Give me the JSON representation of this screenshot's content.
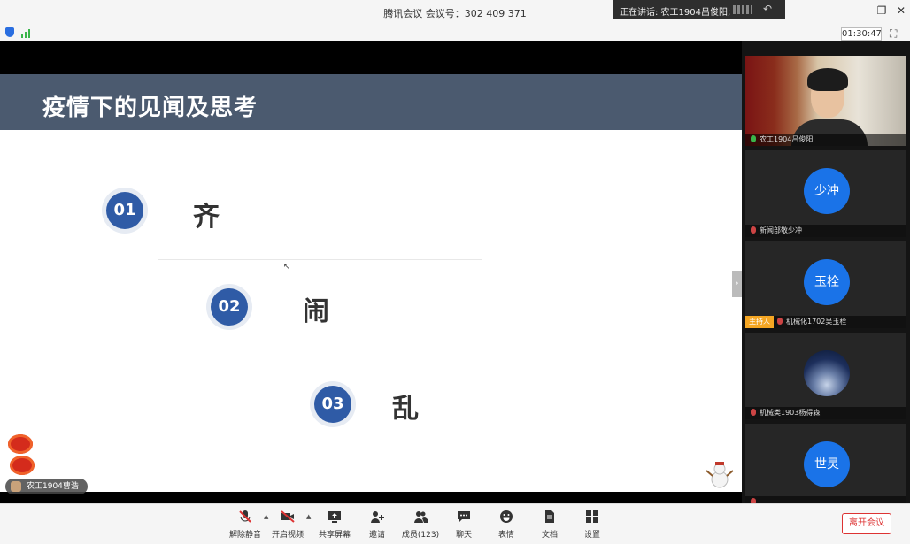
{
  "window": {
    "title": "腾讯会议 会议号：302 409 371",
    "speaking_text": "正在讲话: 农工1904吕俊阳;",
    "timer": "01:30:47"
  },
  "slide": {
    "title": "疫情下的见闻及思考",
    "items": [
      {
        "num": "01",
        "word": "齐"
      },
      {
        "num": "02",
        "word": "闹"
      },
      {
        "num": "03",
        "word": "乱"
      }
    ],
    "presenter_tag": "农工1904曹浩"
  },
  "participants": {
    "camera": {
      "name": "农工1904吕俊阳"
    },
    "tiles": [
      {
        "avatar_text": "少冲",
        "name": "新闻部敬少冲",
        "host": false
      },
      {
        "avatar_text": "玉栓",
        "name": "机械化1702吴玉栓",
        "host": true,
        "host_label": "主持人"
      },
      {
        "avatar_text": "",
        "name": "机械类1903杨得森",
        "host": false,
        "photo": true
      },
      {
        "avatar_text": "世灵",
        "name": "",
        "host": false
      }
    ]
  },
  "toolbar": {
    "unmute": "解除静音",
    "start_video": "开启视频",
    "share_screen": "共享屏幕",
    "invite": "邀请",
    "members": "成员(123)",
    "chat": "聊天",
    "reactions": "表情",
    "docs": "文档",
    "settings": "设置",
    "leave": "离开会议"
  },
  "colors": {
    "slide_header": "#4b5a6f",
    "number_circle": "#2f5ba6",
    "avatar": "#1a73e8",
    "leave": "#dd3333",
    "host_badge": "#f5a623"
  }
}
